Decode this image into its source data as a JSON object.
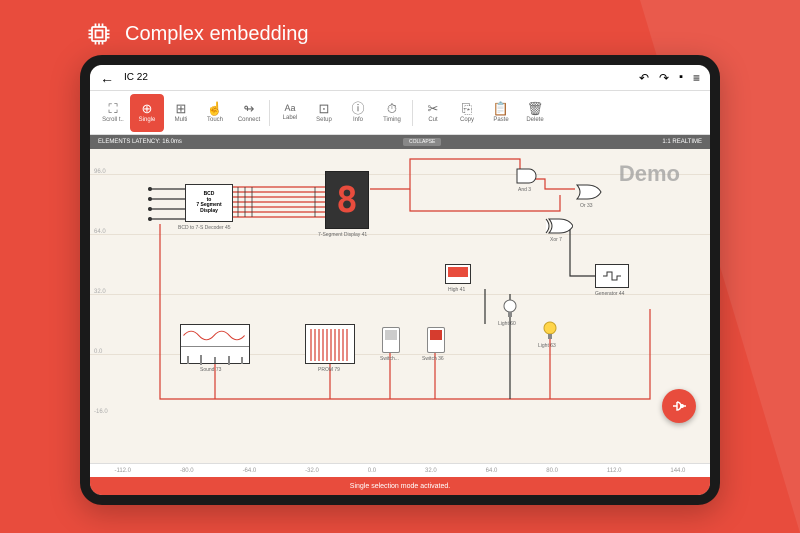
{
  "page": {
    "title": "Complex embedding"
  },
  "app": {
    "title": "IC 22",
    "watermark": "Demo",
    "status_left": "ELEMENTS LATENCY: 16.0ms",
    "status_right": "1:1 REALTIME",
    "collapse_label": "COLLAPSE",
    "footer_message": "Single selection mode activated."
  },
  "toolbar": [
    {
      "id": "scroll",
      "label": "Scroll t..",
      "icon": "⛶"
    },
    {
      "id": "single",
      "label": "Single",
      "icon": "⊕",
      "active": true
    },
    {
      "id": "multi",
      "label": "Multi",
      "icon": "⊞"
    },
    {
      "id": "touch",
      "label": "Touch",
      "icon": "☝"
    },
    {
      "id": "connect",
      "label": "Connect",
      "icon": "↬"
    },
    {
      "id": "label",
      "label": "Label",
      "icon": "Aa"
    },
    {
      "id": "setup",
      "label": "Setup",
      "icon": "⊡"
    },
    {
      "id": "info",
      "label": "Info",
      "icon": "ⓘ"
    },
    {
      "id": "timing",
      "label": "Timing",
      "icon": "⏱"
    },
    {
      "id": "cut",
      "label": "Cut",
      "icon": "✂"
    },
    {
      "id": "copy",
      "label": "Copy",
      "icon": "⎘"
    },
    {
      "id": "paste",
      "label": "Paste",
      "icon": "📋"
    },
    {
      "id": "delete",
      "label": "Delete",
      "icon": "🗑"
    }
  ],
  "ruler_x": [
    "-112.0",
    "-80.0",
    "-64.0",
    "-32.0",
    "0.0",
    "32.0",
    "64.0",
    "80.0",
    "112.0",
    "144.0"
  ],
  "axis_y": [
    "96.0",
    "64.0",
    "32.0",
    "0.0",
    "-16.0"
  ],
  "components": {
    "bcd": {
      "label": "BCD to 7-S Decoder 45",
      "text": "BCD\nto\n7 Segment\nDisplay"
    },
    "seg": {
      "label": "7-Segment Display 41",
      "value": "8"
    },
    "and": {
      "label": "And 3"
    },
    "or": {
      "label": "Or 33"
    },
    "xor": {
      "label": "Xor 7"
    },
    "sound": {
      "label": "Sound 73"
    },
    "prom": {
      "label": "PROM 79"
    },
    "switch1": {
      "label": "Switch..."
    },
    "switch2": {
      "label": "Switch 36"
    },
    "high": {
      "label": "High 41"
    },
    "gen": {
      "label": "Generator 44"
    },
    "light1": {
      "label": "Light 60"
    },
    "light2": {
      "label": "Light 63"
    }
  }
}
